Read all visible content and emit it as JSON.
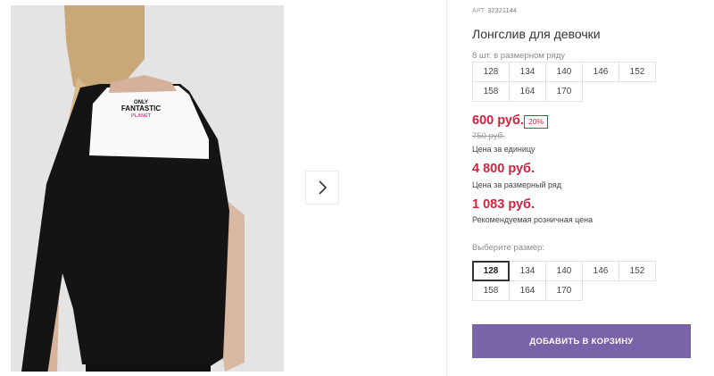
{
  "product": {
    "sku_label": "АРТ",
    "sku": "32321144",
    "title": "Лонгслив для девочки",
    "series_note": "8 шт. в размерном ряду",
    "series_sizes": [
      "128",
      "134",
      "140",
      "146",
      "152",
      "158",
      "164",
      "170"
    ],
    "price": "600 руб.",
    "discount": "20%",
    "old_price": "750 руб.",
    "price_unit_label": "Цена за единицу",
    "series_price": "4 800 руб.",
    "series_price_label": "Цена за размерный ряд",
    "retail_price": "1 083 руб.",
    "retail_price_label": "Рекомендуемая розничная цена",
    "choose_size_label": "Выберите размер:",
    "size_options": [
      "128",
      "134",
      "140",
      "146",
      "152",
      "158",
      "164",
      "170"
    ],
    "selected_size": "128",
    "add_to_cart": "ДОБАВИТЬ В КОРЗИНУ"
  },
  "gallery": {
    "print_lines": [
      "ONLY",
      "FANTASTIC",
      "PLANET"
    ],
    "next_icon": "chevron-right-icon"
  },
  "colors": {
    "price": "#d5213b",
    "cart_button": "#7a63a8",
    "print_accent": "#e0459a"
  }
}
